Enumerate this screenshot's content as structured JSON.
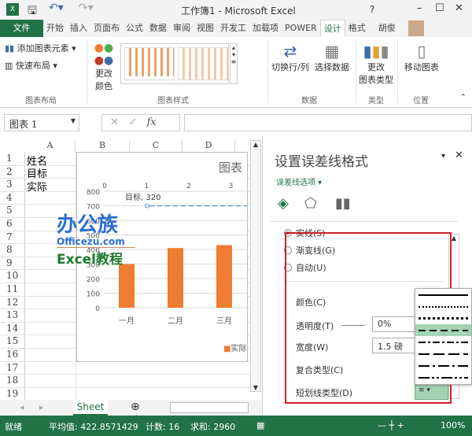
{
  "window": {
    "title": "工作簿1 - Microsoft Excel",
    "help": "?"
  },
  "tabs": [
    {
      "label": "文件"
    },
    {
      "label": "开始"
    },
    {
      "label": "插入"
    },
    {
      "label": "页面布"
    },
    {
      "label": "公式"
    },
    {
      "label": "数据"
    },
    {
      "label": "审阅"
    },
    {
      "label": "视图"
    },
    {
      "label": "开发工"
    },
    {
      "label": "加载项"
    },
    {
      "label": "POWER"
    },
    {
      "label": "设计"
    },
    {
      "label": "格式"
    }
  ],
  "user": "胡俊",
  "ribbon": {
    "add_element": "添加图表元素",
    "quick_layout": "快速布局",
    "change_color_1": "更改",
    "change_color_2": "颜色",
    "switch_rowcol": "切换行/列",
    "select_data": "选择数据",
    "change_type_1": "更改",
    "change_type_2": "图表类型",
    "move_chart": "移动图表",
    "groups": {
      "layout": "图表布局",
      "styles": "图表样式",
      "data": "数据",
      "type": "类型",
      "location": "位置"
    }
  },
  "formula_bar": {
    "name_box": "图表 1",
    "fx": "fx",
    "value": ""
  },
  "columns": [
    "A",
    "B",
    "C",
    "D"
  ],
  "rows": [
    "1",
    "2",
    "3",
    "4",
    "5",
    "6",
    "7",
    "8",
    "9",
    "10",
    "11",
    "12",
    "13",
    "14",
    "15",
    "16",
    "17",
    "18",
    "19"
  ],
  "cells": {
    "A1": "姓名",
    "A2": "目标",
    "A3": "实际"
  },
  "chart_data": {
    "type": "bar",
    "title": "图表",
    "categories": [
      "一月",
      "二月",
      "三月"
    ],
    "series": [
      {
        "name": "实际",
        "values": [
          300,
          410,
          430
        ],
        "color": "#ed7d31"
      }
    ],
    "target_line": {
      "label": "目标, 320",
      "value": 700,
      "color": "#5b9bd5"
    },
    "ylim": [
      0,
      800
    ],
    "yticks": [
      "0",
      "100",
      "200",
      "300",
      "400",
      "500",
      "600",
      "700",
      "800"
    ],
    "x2ticks": [
      "0",
      "1",
      "2",
      "3"
    ],
    "legend_label": "实际"
  },
  "watermark": {
    "line1": "办公族",
    "line2": "Officezu.com",
    "line3": "Excel教程"
  },
  "pane": {
    "title": "设置误差线格式",
    "options_label": "误差线选项",
    "radios": [
      {
        "label": "实线(S)",
        "checked": true
      },
      {
        "label": "渐变线(G)",
        "checked": false
      },
      {
        "label": "自动(U)",
        "checked": false
      }
    ],
    "color_label": "颜色(C)",
    "transparency_label": "透明度(T)",
    "transparency_value": "0%",
    "width_label": "宽度(W)",
    "width_value": "1.5 磅",
    "compound_label": "复合类型(C)",
    "dash_label": "短划线类型(D)"
  },
  "sheet_tab": "Sheet",
  "status": {
    "ready": "就绪",
    "average": "平均值: 422.8571429",
    "count": "计数: 16",
    "sum": "求和: 2960",
    "zoom": "100%"
  }
}
